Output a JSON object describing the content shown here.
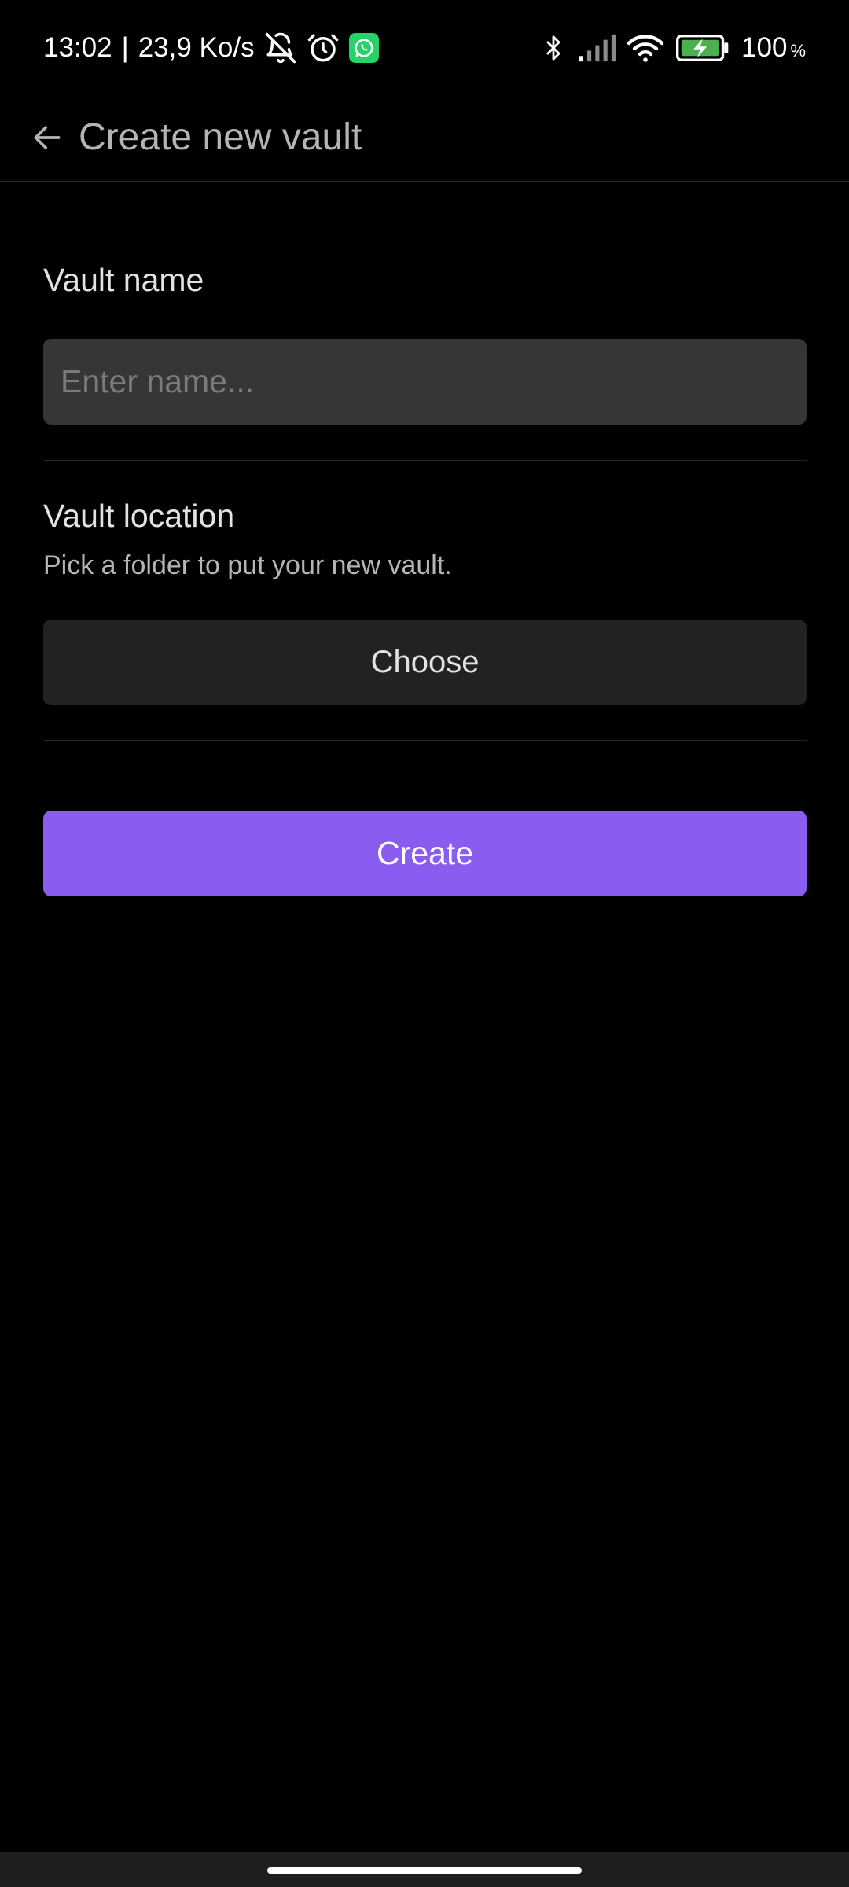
{
  "status_bar": {
    "time": "13:02",
    "separator": "|",
    "network_speed": "23,9 Ko/s",
    "left_icons": [
      "bell-off-icon",
      "alarm-icon",
      "whatsapp-icon"
    ],
    "right_icons": [
      "bluetooth-icon",
      "signal-icon",
      "wifi-icon",
      "battery-charging-icon"
    ],
    "battery_value": "100",
    "battery_unit": "%",
    "battery_color": "#4caf50",
    "whatsapp_color": "#25d366"
  },
  "app_bar": {
    "back_icon": "arrow-left-icon",
    "title": "Create new vault"
  },
  "form": {
    "name_label": "Vault name",
    "name_placeholder": "Enter name...",
    "name_value": "",
    "location_label": "Vault location",
    "location_description": "Pick a folder to put your new vault.",
    "choose_label": "Choose",
    "create_label": "Create",
    "accent_color": "#8a5cf0"
  }
}
